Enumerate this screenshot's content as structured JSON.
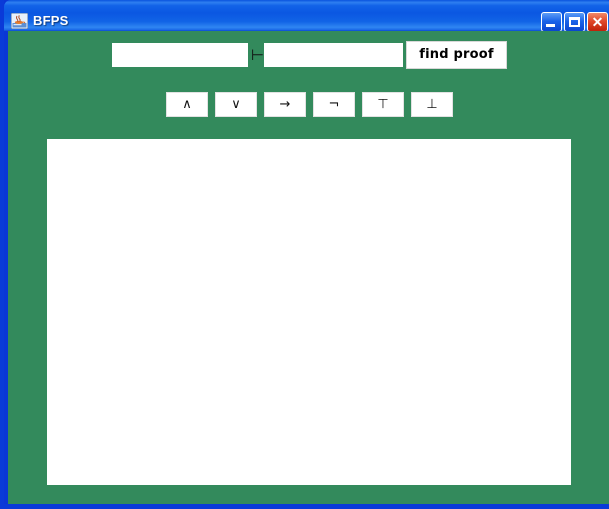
{
  "window": {
    "title": "BFPS",
    "icon": "java-coffee-cup-icon",
    "background_color": "#338a5c",
    "titlebar_color": "#0b57e2",
    "border_color": "#0a3ad8",
    "controls": {
      "minimize_label": "–",
      "maximize_label": "□",
      "close_label": "✕"
    }
  },
  "toolbar": {
    "premise_field": {
      "value": "",
      "placeholder": ""
    },
    "turnstile_symbol": "⊢",
    "conclusion_field": {
      "value": "",
      "placeholder": ""
    },
    "find_proof_label": "find proof"
  },
  "operators": [
    {
      "name": "and",
      "symbol": "∧"
    },
    {
      "name": "or",
      "symbol": "∨"
    },
    {
      "name": "implies",
      "symbol": "→"
    },
    {
      "name": "not",
      "symbol": "¬"
    },
    {
      "name": "top",
      "symbol": "⊤"
    },
    {
      "name": "bottom",
      "symbol": "⊥"
    }
  ],
  "proof_output": {
    "text": ""
  }
}
